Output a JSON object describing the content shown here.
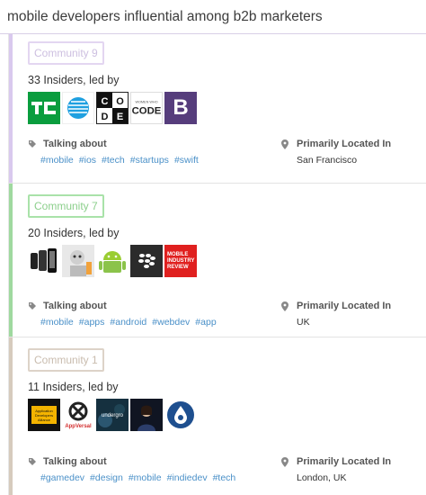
{
  "header": {
    "title": "mobile developers influential among b2b marketers"
  },
  "labels": {
    "talking_about": "Talking about",
    "primarily_located": "Primarily Located In"
  },
  "communities": [
    {
      "badge": "Community 9",
      "accent": "#e3d6f1",
      "stripe": "#d9c9ee",
      "insiders": "33 Insiders, led by",
      "avatars": [
        {
          "name": "techcrunch-logo",
          "text": "TC"
        },
        {
          "name": "att-logo",
          "text": ""
        },
        {
          "name": "code-logo",
          "text": "C O D E"
        },
        {
          "name": "women-who-code-logo",
          "text": "CODE"
        },
        {
          "name": "bootstrap-logo",
          "text": "B"
        }
      ],
      "tags": [
        "#mobile",
        "#ios",
        "#tech",
        "#startups",
        "#swift"
      ],
      "location": "San Francisco"
    },
    {
      "badge": "Community 7",
      "accent": "#a9e2a9",
      "stripe": "#9fd99f",
      "insiders": "20 Insiders, led by",
      "avatars": [
        {
          "name": "phones-avatar",
          "text": ""
        },
        {
          "name": "robot-avatar",
          "text": ""
        },
        {
          "name": "android-avatar",
          "text": ""
        },
        {
          "name": "blackberry-avatar",
          "text": ""
        },
        {
          "name": "mobile-industry-review-logo",
          "text": "MOBILE INDUSTRY REVIEW"
        }
      ],
      "tags": [
        "#mobile",
        "#apps",
        "#android",
        "#webdev",
        "#app"
      ],
      "location": "UK"
    },
    {
      "badge": "Community 1",
      "accent": "#ddd3c8",
      "stripe": "#d6cbbd",
      "insiders": "11 Insiders, led by",
      "avatars": [
        {
          "name": "app-developers-alliance-logo",
          "text": "Application Developers Alliance"
        },
        {
          "name": "appversal-logo",
          "text": "AppVersal"
        },
        {
          "name": "underground-avatar",
          "text": "undergro"
        },
        {
          "name": "person-avatar",
          "text": ""
        },
        {
          "name": "drop-logo-avatar",
          "text": ""
        }
      ],
      "tags": [
        "#gamedev",
        "#design",
        "#mobile",
        "#indiedev",
        "#tech"
      ],
      "location": "London, UK"
    }
  ]
}
